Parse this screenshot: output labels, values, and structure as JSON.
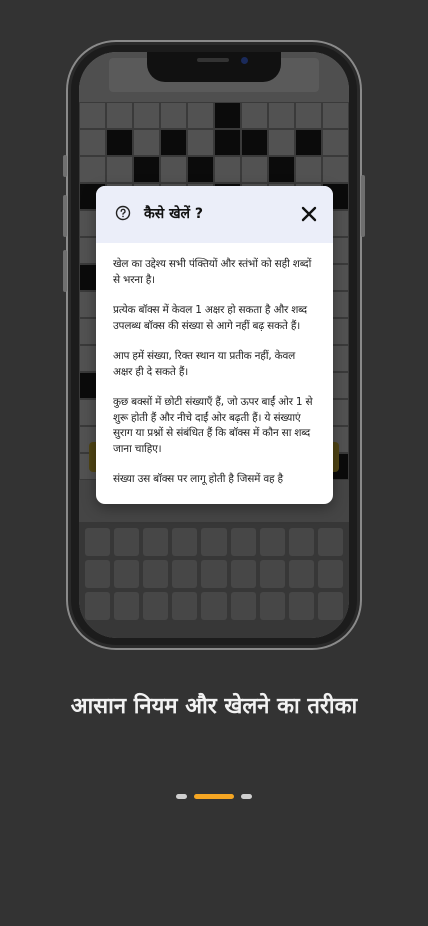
{
  "dialog": {
    "title": "कैसे खेलें ?",
    "paragraphs": [
      "खेल का उद्देश्य सभी पंक्तियों और स्तंभों को सही शब्दों से भरना है।",
      "प्रत्येक बॉक्स में केवल 1 अक्षर हो सकता है और शब्द उपलब्ध बॉक्स की संख्या से आगे नहीं बढ़ सकते हैं।",
      "आप हमें संख्या, रिक्त स्थान या प्रतीक नहीं, केवल अक्षर ही दे सकते हैं।",
      "कुछ बक्सों में छोटी संख्याएँ हैं, जो ऊपर बाईं ओर 1 से शुरू होती हैं और नीचे दाईं ओर बढ़ती हैं। ये संख्याएं सुराग या प्रश्नों से संबंधित हैं कि बॉक्स में कौन सा शब्द जाना चाहिए।",
      "संख्या उस बॉक्स पर लागू होती है जिसमें वह है"
    ]
  },
  "caption": "आसान नियम और खेलने का तरीका",
  "pager": {
    "count": 3,
    "active_index": 1,
    "active_color": "#f5a623",
    "inactive_color": "#cfcfcf"
  },
  "icons": {
    "help": "help-circle-icon",
    "close": "close-icon"
  }
}
